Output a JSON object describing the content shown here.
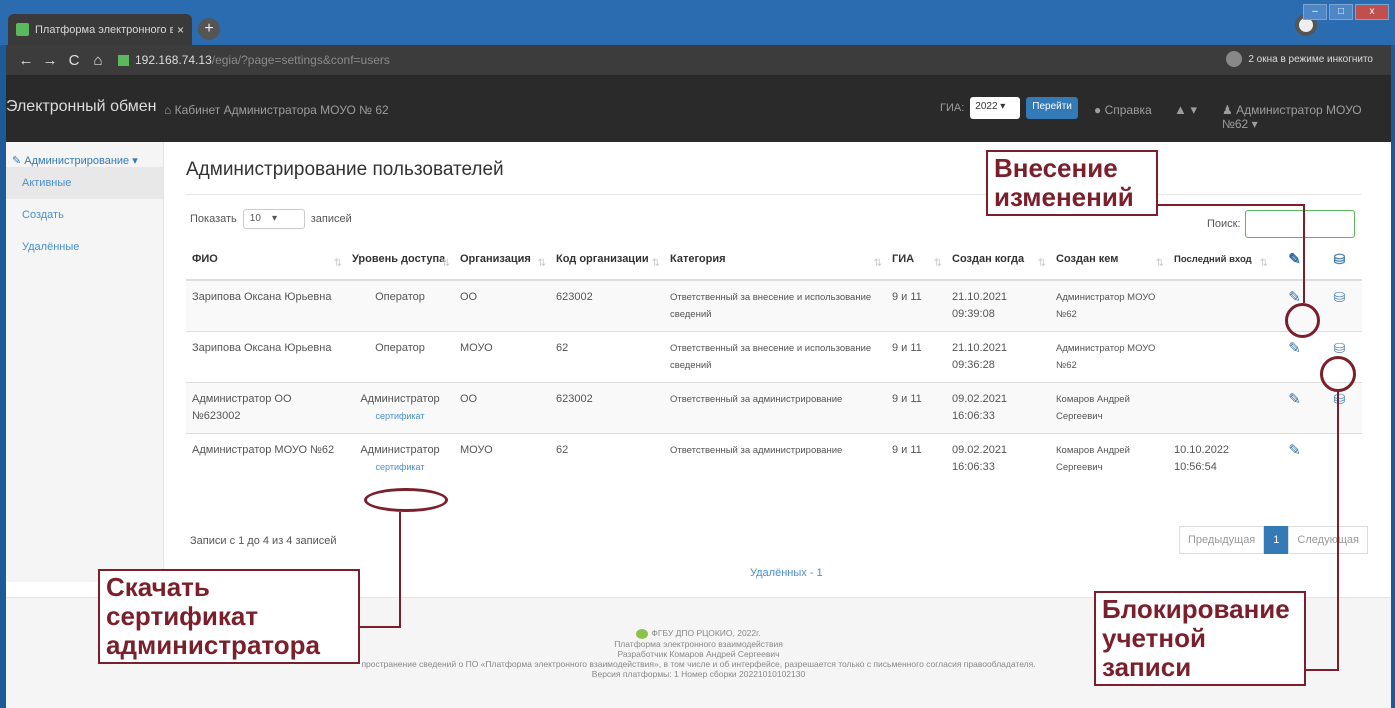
{
  "browser": {
    "tab_title": "Платформа электронного взаи",
    "tab_close": "×",
    "new_tab": "+",
    "url_host": "192.168.74.13",
    "url_path": "/egia/?page=settings&conf=users",
    "incognito": "2 окна в режиме инкогнито",
    "back": "←",
    "forward": "→",
    "reload": "C",
    "home": "⌂"
  },
  "navbar": {
    "brand": "Электронный обмен",
    "breadcrumb": "Кабинет Администратора МОУО № 62",
    "gia_label": "ГИА:",
    "gia_value": "2022",
    "go_label": "Перейти",
    "help_label": "Справка",
    "bell": "▾",
    "user_label": "Администратор МОУО №62"
  },
  "sidebar": {
    "header": "Администрирование",
    "items": [
      {
        "label": "Активные"
      },
      {
        "label": "Создать"
      },
      {
        "label": "Удалённые"
      }
    ]
  },
  "main": {
    "title": "Администрирование пользователей",
    "show_prefix": "Показать",
    "show_value": "10",
    "show_suffix": "записей",
    "search_label": "Поиск:",
    "columns": [
      "ФИО",
      "Уровень доступа",
      "Организация",
      "Код организации",
      "Категория",
      "ГИА",
      "Создан когда",
      "Создан кем",
      "Последний вход"
    ],
    "rows": [
      {
        "fio": "Зарипова Оксана Юрьевна",
        "level": "Оператор",
        "cert": "",
        "org": "ОО",
        "code": "623002",
        "category": "Ответственный за внесение и использование сведений",
        "gia": "9 и 11",
        "created": "21.10.2021 09:39:08",
        "by": "Администратор МОУО №62",
        "last": ""
      },
      {
        "fio": "Зарипова Оксана Юрьевна",
        "level": "Оператор",
        "cert": "",
        "org": "МОУО",
        "code": "62",
        "category": "Ответственный за внесение и использование сведений",
        "gia": "9 и 11",
        "created": "21.10.2021 09:36:28",
        "by": "Администратор МОУО №62",
        "last": ""
      },
      {
        "fio": "Администратор ОО №623002",
        "level": "Администратор",
        "cert": "сертификат",
        "org": "ОО",
        "code": "623002",
        "category": "Ответственный за администрирование",
        "gia": "9 и 11",
        "created": "09.02.2021 16:06:33",
        "by": "Комаров Андрей Сергеевич",
        "last": ""
      },
      {
        "fio": "Администратор МОУО №62",
        "level": "Администратор",
        "cert": "сертификат",
        "org": "МОУО",
        "code": "62",
        "category": "Ответственный за администрирование",
        "gia": "9 и 11",
        "created": "09.02.2021 16:06:33",
        "by": "Комаров Андрей Сергеевич",
        "last": "10.10.2022 10:56:54"
      }
    ],
    "info": "Записи с 1 до 4 из 4 записей",
    "prev": "Предыдущая",
    "page": "1",
    "next": "Следующая",
    "deleted": "Удалённых - 1"
  },
  "footer": {
    "line1": "ФГБУ ДПО РЦОКИО, 2022г.",
    "line2": "Платформа электронного взаимодействия",
    "line3": "Разработчик Комаров Андрей Сергеевич",
    "line4": "пространение сведений о ПО «Платформа электронного взаимодействия», в том числе и об интерфейсе, разрешается только с письменного согласия правообладателя.",
    "line5": "Версия платформы: 1 Номер сборки 20221010102130"
  },
  "annotations": {
    "edit": "Внесение изменений",
    "cert": "Скачать сертификат администратора",
    "block": "Блокирование учетной записи"
  },
  "colors": {
    "annotation": "#7a1f2b",
    "link": "#337ab7",
    "navbar": "#2a2a2a"
  }
}
